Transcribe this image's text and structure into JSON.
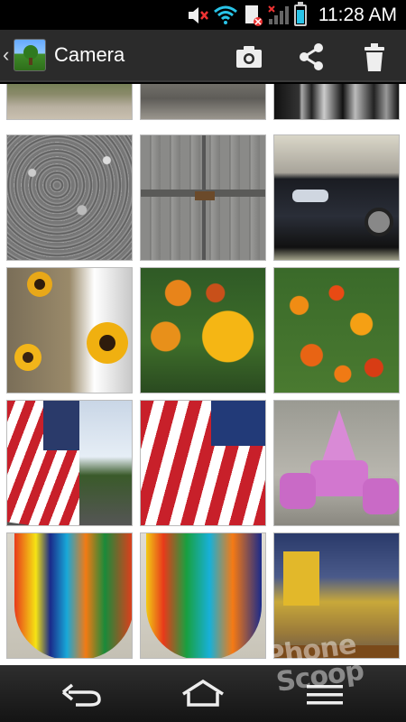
{
  "status_bar": {
    "time": "11:28 AM",
    "icons": [
      "mute-icon",
      "wifi-icon",
      "sim-error-icon",
      "signal-icon",
      "battery-icon"
    ],
    "battery_color": "#29c4e8"
  },
  "action_bar": {
    "title": "Camera",
    "actions": [
      "camera-icon",
      "share-icon",
      "trash-icon"
    ]
  },
  "gallery": {
    "photos": [
      {
        "name": "photo-stone-path",
        "subject": "stone path garden"
      },
      {
        "name": "photo-stone-wall",
        "subject": "stone wall"
      },
      {
        "name": "photo-dark-trees",
        "subject": "dark trees"
      },
      {
        "name": "photo-gravel",
        "subject": "gravel"
      },
      {
        "name": "photo-barn-door",
        "subject": "barn door"
      },
      {
        "name": "photo-car",
        "subject": "black car"
      },
      {
        "name": "photo-black-eyed-susans",
        "subject": "black-eyed susans"
      },
      {
        "name": "photo-marigolds-1",
        "subject": "marigolds"
      },
      {
        "name": "photo-marigolds-2",
        "subject": "marigolds"
      },
      {
        "name": "photo-flag-street",
        "subject": "flag on street"
      },
      {
        "name": "photo-flag-closeup",
        "subject": "flag closeup"
      },
      {
        "name": "photo-pink-toys",
        "subject": "pink toy furniture"
      },
      {
        "name": "photo-balloon-1",
        "subject": "balloon windsock"
      },
      {
        "name": "photo-balloon-2",
        "subject": "balloon windsock"
      },
      {
        "name": "photo-painting",
        "subject": "cafe terrace painting"
      }
    ]
  },
  "nav_bar": {
    "buttons": [
      "back-icon",
      "home-icon",
      "menu-icon"
    ]
  },
  "watermark": {
    "line1": "Phone",
    "line2": "Scoop"
  }
}
